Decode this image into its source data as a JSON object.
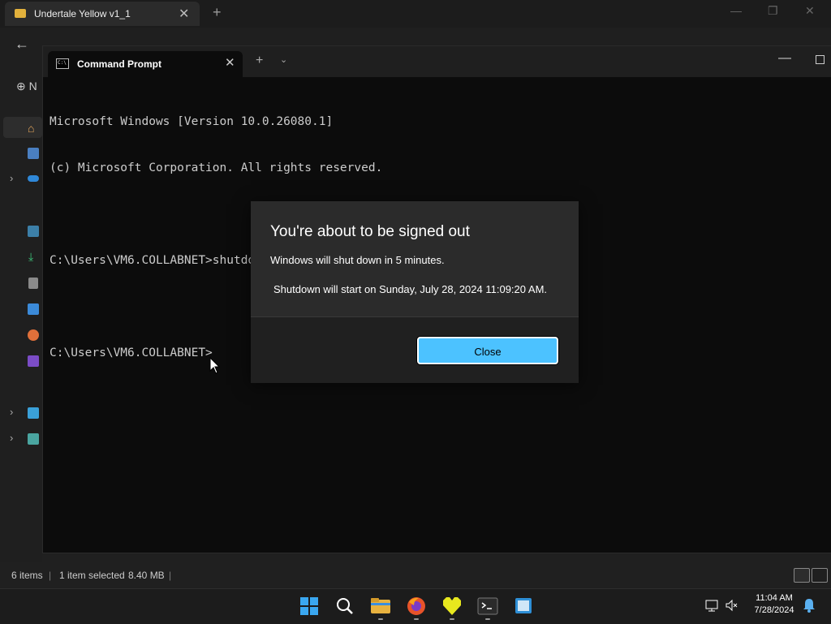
{
  "explorer": {
    "tab_title": "Undertale Yellow v1_1",
    "new_button_label": "N",
    "status": {
      "items": "6 items",
      "selected": "1 item selected",
      "size": "8.40 MB"
    }
  },
  "terminal": {
    "tab_title": "Command Prompt",
    "tab_icon_text": "C:\\",
    "lines": [
      "Microsoft Windows [Version 10.0.26080.1]",
      "(c) Microsoft Corporation. All rights reserved.",
      "",
      "C:\\Users\\VM6.COLLABNET>shutdown -s -t 300",
      "",
      "C:\\Users\\VM6.COLLABNET>"
    ]
  },
  "dialog": {
    "title": "You're about to be signed out",
    "message": "Windows will shut down in 5 minutes.",
    "detail": "Shutdown will start on Sunday, July 28, 2024 11:09:20 AM.",
    "close_label": "Close",
    "accent_color": "#4cc2ff"
  },
  "taskbar": {
    "apps": [
      "start-icon",
      "search-icon",
      "file-explorer-icon",
      "firefox-icon",
      "undertale-heart-icon",
      "terminal-icon",
      "notepad-icon"
    ],
    "time": "11:04 AM",
    "date": "7/28/2024"
  }
}
